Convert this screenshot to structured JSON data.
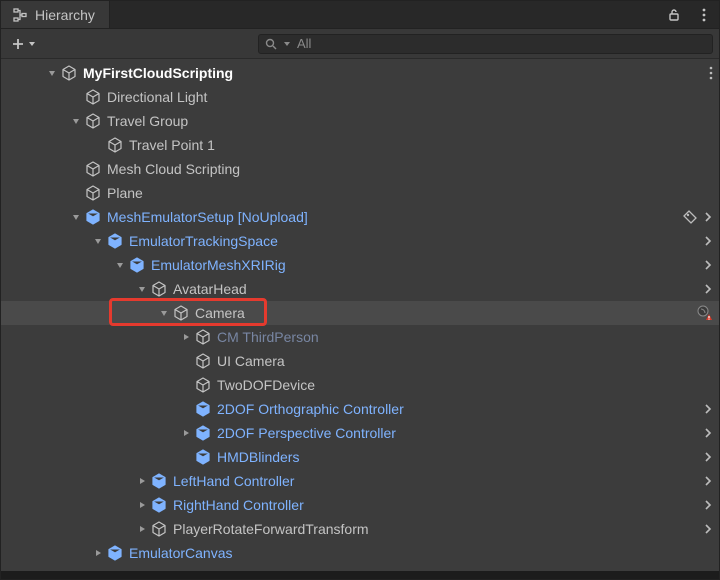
{
  "tab": {
    "title": "Hierarchy"
  },
  "search": {
    "text": "All"
  },
  "scene": {
    "name": "MyFirstCloudScripting",
    "children": [
      {
        "name": "Directional Light",
        "kind": "normal",
        "fold": "none"
      },
      {
        "name": "Travel Group",
        "kind": "normal",
        "fold": "open",
        "children": [
          {
            "name": "Travel Point 1",
            "kind": "normal",
            "fold": "none"
          }
        ]
      },
      {
        "name": "Mesh Cloud Scripting",
        "kind": "normal",
        "fold": "none"
      },
      {
        "name": "Plane",
        "kind": "normal",
        "fold": "none"
      },
      {
        "name": "MeshEmulatorSetup [NoUpload]",
        "kind": "prefab",
        "fold": "open",
        "tag": true,
        "chev": true,
        "children": [
          {
            "name": "EmulatorTrackingSpace",
            "kind": "prefab",
            "fold": "open",
            "chev": true,
            "children": [
              {
                "name": "EmulatorMeshXRIRig",
                "kind": "prefab",
                "fold": "open",
                "chev": true,
                "children": [
                  {
                    "name": "AvatarHead",
                    "kind": "normal",
                    "fold": "open",
                    "chev": true,
                    "children": [
                      {
                        "name": "Camera",
                        "kind": "normal",
                        "fold": "open",
                        "selected": true,
                        "warn": true,
                        "highlight": true,
                        "children": [
                          {
                            "name": "CM ThirdPerson",
                            "kind": "dim",
                            "fold": "closed"
                          },
                          {
                            "name": "UI Camera",
                            "kind": "normal",
                            "fold": "none"
                          },
                          {
                            "name": "TwoDOFDevice",
                            "kind": "normal",
                            "fold": "none"
                          },
                          {
                            "name": "2DOF Orthographic Controller",
                            "kind": "prefab",
                            "fold": "none",
                            "chev": true
                          },
                          {
                            "name": "2DOF Perspective Controller",
                            "kind": "prefab",
                            "fold": "closed",
                            "chev": true
                          },
                          {
                            "name": "HMDBlinders",
                            "kind": "prefab",
                            "fold": "none",
                            "chev": true
                          }
                        ]
                      }
                    ]
                  },
                  {
                    "name": "LeftHand Controller",
                    "kind": "prefab",
                    "fold": "closed",
                    "chev": true
                  },
                  {
                    "name": "RightHand Controller",
                    "kind": "prefab",
                    "fold": "closed",
                    "chev": true
                  },
                  {
                    "name": "PlayerRotateForwardTransform",
                    "kind": "normal",
                    "fold": "closed",
                    "chev": true
                  }
                ]
              }
            ]
          },
          {
            "name": "EmulatorCanvas",
            "kind": "prefab",
            "fold": "closed"
          }
        ]
      }
    ]
  }
}
